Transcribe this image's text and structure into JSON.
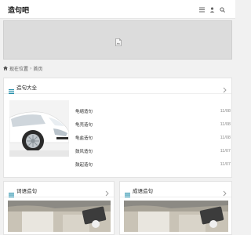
{
  "site": {
    "logo": "造句吧"
  },
  "header": {
    "icons": [
      "menu-icon",
      "user-icon",
      "search-icon"
    ]
  },
  "banner": {
    "icon": "broken-image-icon"
  },
  "breadcrumb": {
    "home_icon": "home-icon",
    "current_label": "现在位置",
    "separator": "›",
    "page": "首页"
  },
  "main_section": {
    "title": "造句大全",
    "items": [
      {
        "title": "龟缩造句",
        "date": "11/08"
      },
      {
        "title": "龟壳造句",
        "date": "11/08"
      },
      {
        "title": "龟盐造句",
        "date": "11/08"
      },
      {
        "title": "鼓风造句",
        "date": "11/07"
      },
      {
        "title": "鼓起造句",
        "date": "11/07"
      }
    ]
  },
  "sub_sections": [
    {
      "title": "词语造句"
    },
    {
      "title": "成语造句"
    }
  ],
  "colors": {
    "accent": "#1f8ba8",
    "background": "#f1f1f1",
    "banner": "#dcdcdc"
  }
}
